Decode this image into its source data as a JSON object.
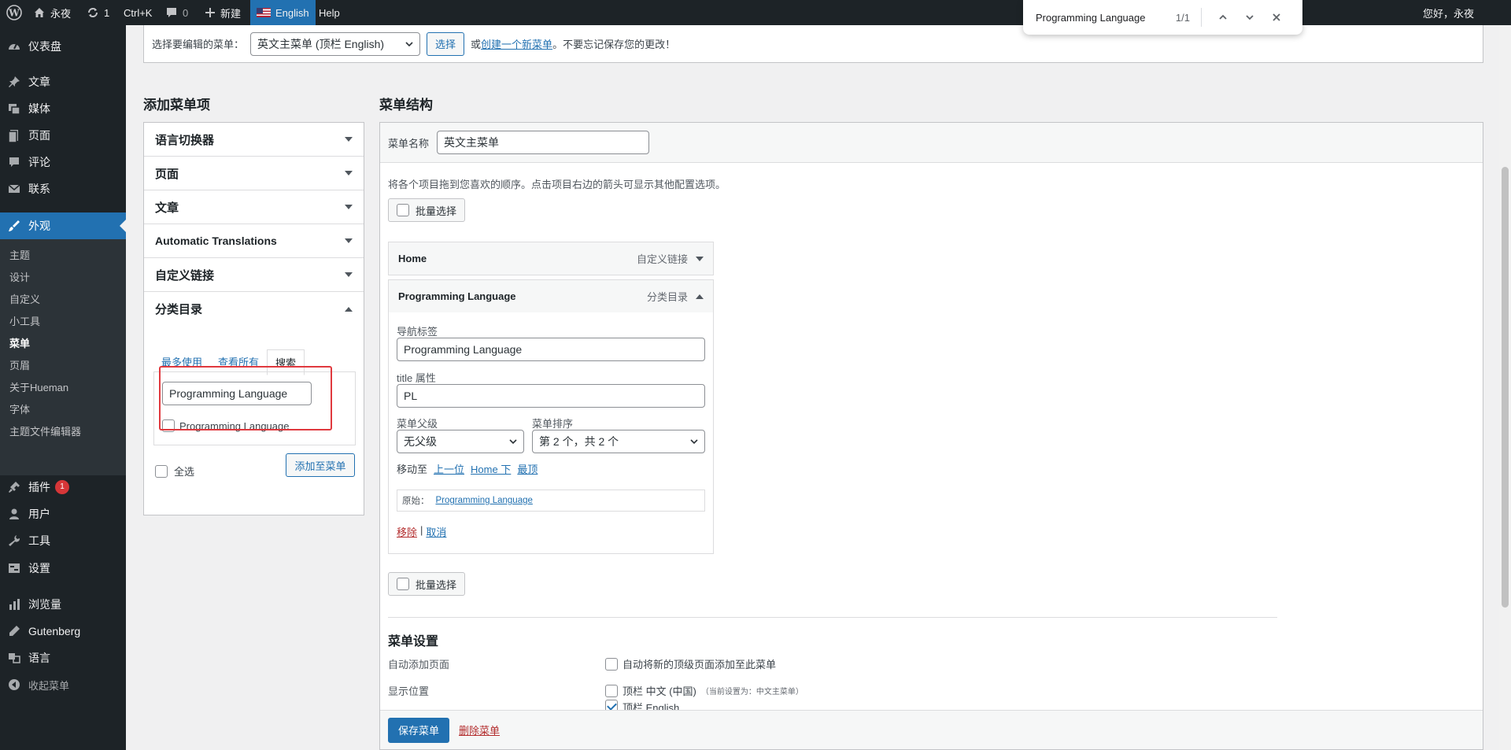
{
  "adminbar": {
    "site_name": "永夜",
    "updates_count": "1",
    "shortcut": "Ctrl+K",
    "comments_count": "0",
    "new_label": "新建",
    "language_label": "English",
    "help_label": "Help",
    "greeting": "您好，永夜"
  },
  "sidebar": {
    "dashboard": "仪表盘",
    "posts": "文章",
    "media": "媒体",
    "pages": "页面",
    "comments": "评论",
    "contact": "联系",
    "appearance": "外观",
    "submenu": [
      "主题",
      "设计",
      "自定义",
      "小工具",
      "菜单",
      "页眉",
      "关于Hueman",
      "字体",
      "主题文件编辑器"
    ],
    "plugins": "插件",
    "plugins_badge": "1",
    "users": "用户",
    "tools": "工具",
    "settings": "设置",
    "views": "浏览量",
    "gutenberg": "Gutenberg",
    "languages": "语言",
    "collapse": "收起菜单"
  },
  "select_menu": {
    "label": "选择要编辑的菜单：",
    "selected": "英文主菜单 (顶栏 English)",
    "select_button": "选择",
    "or_text": "或",
    "create_link": "创建一个新菜单",
    "reminder": "。不要忘记保存您的更改！"
  },
  "add_items": {
    "title": "添加菜单项",
    "sections": [
      "语言切换器",
      "页面",
      "文章",
      "Automatic Translations",
      "自定义链接",
      "分类目录"
    ],
    "tabs": [
      "最多使用",
      "查看所有",
      "搜索"
    ],
    "search_value": "Programming Language",
    "result_label": "Programming Language",
    "select_all": "全选",
    "add_button": "添加至菜单"
  },
  "structure": {
    "title": "菜单结构",
    "menu_name_label": "菜单名称",
    "menu_name_value": "英文主菜单",
    "instructions": "将各个项目拖到您喜欢的顺序。点击项目右边的箭头可显示其他配置选项。",
    "bulk_select": "批量选择",
    "items": [
      {
        "title": "Home",
        "type": "自定义链接"
      },
      {
        "title": "Programming Language",
        "type": "分类目录"
      }
    ],
    "nav_label_label": "导航标签",
    "nav_label_value": "Programming Language",
    "title_attr_label": "title 属性",
    "title_attr_value": "PL",
    "parent_label": "菜单父级",
    "parent_value": "无父级",
    "order_label": "菜单排序",
    "order_value": "第 2 个，共 2 个",
    "move_label": "移动至",
    "move_links": [
      "上一位",
      "Home 下",
      "最顶"
    ],
    "original_label": "原始：",
    "original_link": "Programming Language",
    "remove": "移除",
    "separator": "|",
    "cancel": "取消"
  },
  "settings": {
    "title": "菜单设置",
    "auto_add_label": "自动添加页面",
    "auto_add_option": "自动将新的顶级页面添加至此菜单",
    "location_label": "显示位置",
    "location_1": "顶栏 中文 (中国)",
    "location_1_note": "（当前设置为：中文主菜单）",
    "location_2": "顶栏 English"
  },
  "footer": {
    "save": "保存菜单",
    "delete": "删除菜单"
  },
  "findbar": {
    "query": "Programming Language",
    "count": "1/1"
  }
}
